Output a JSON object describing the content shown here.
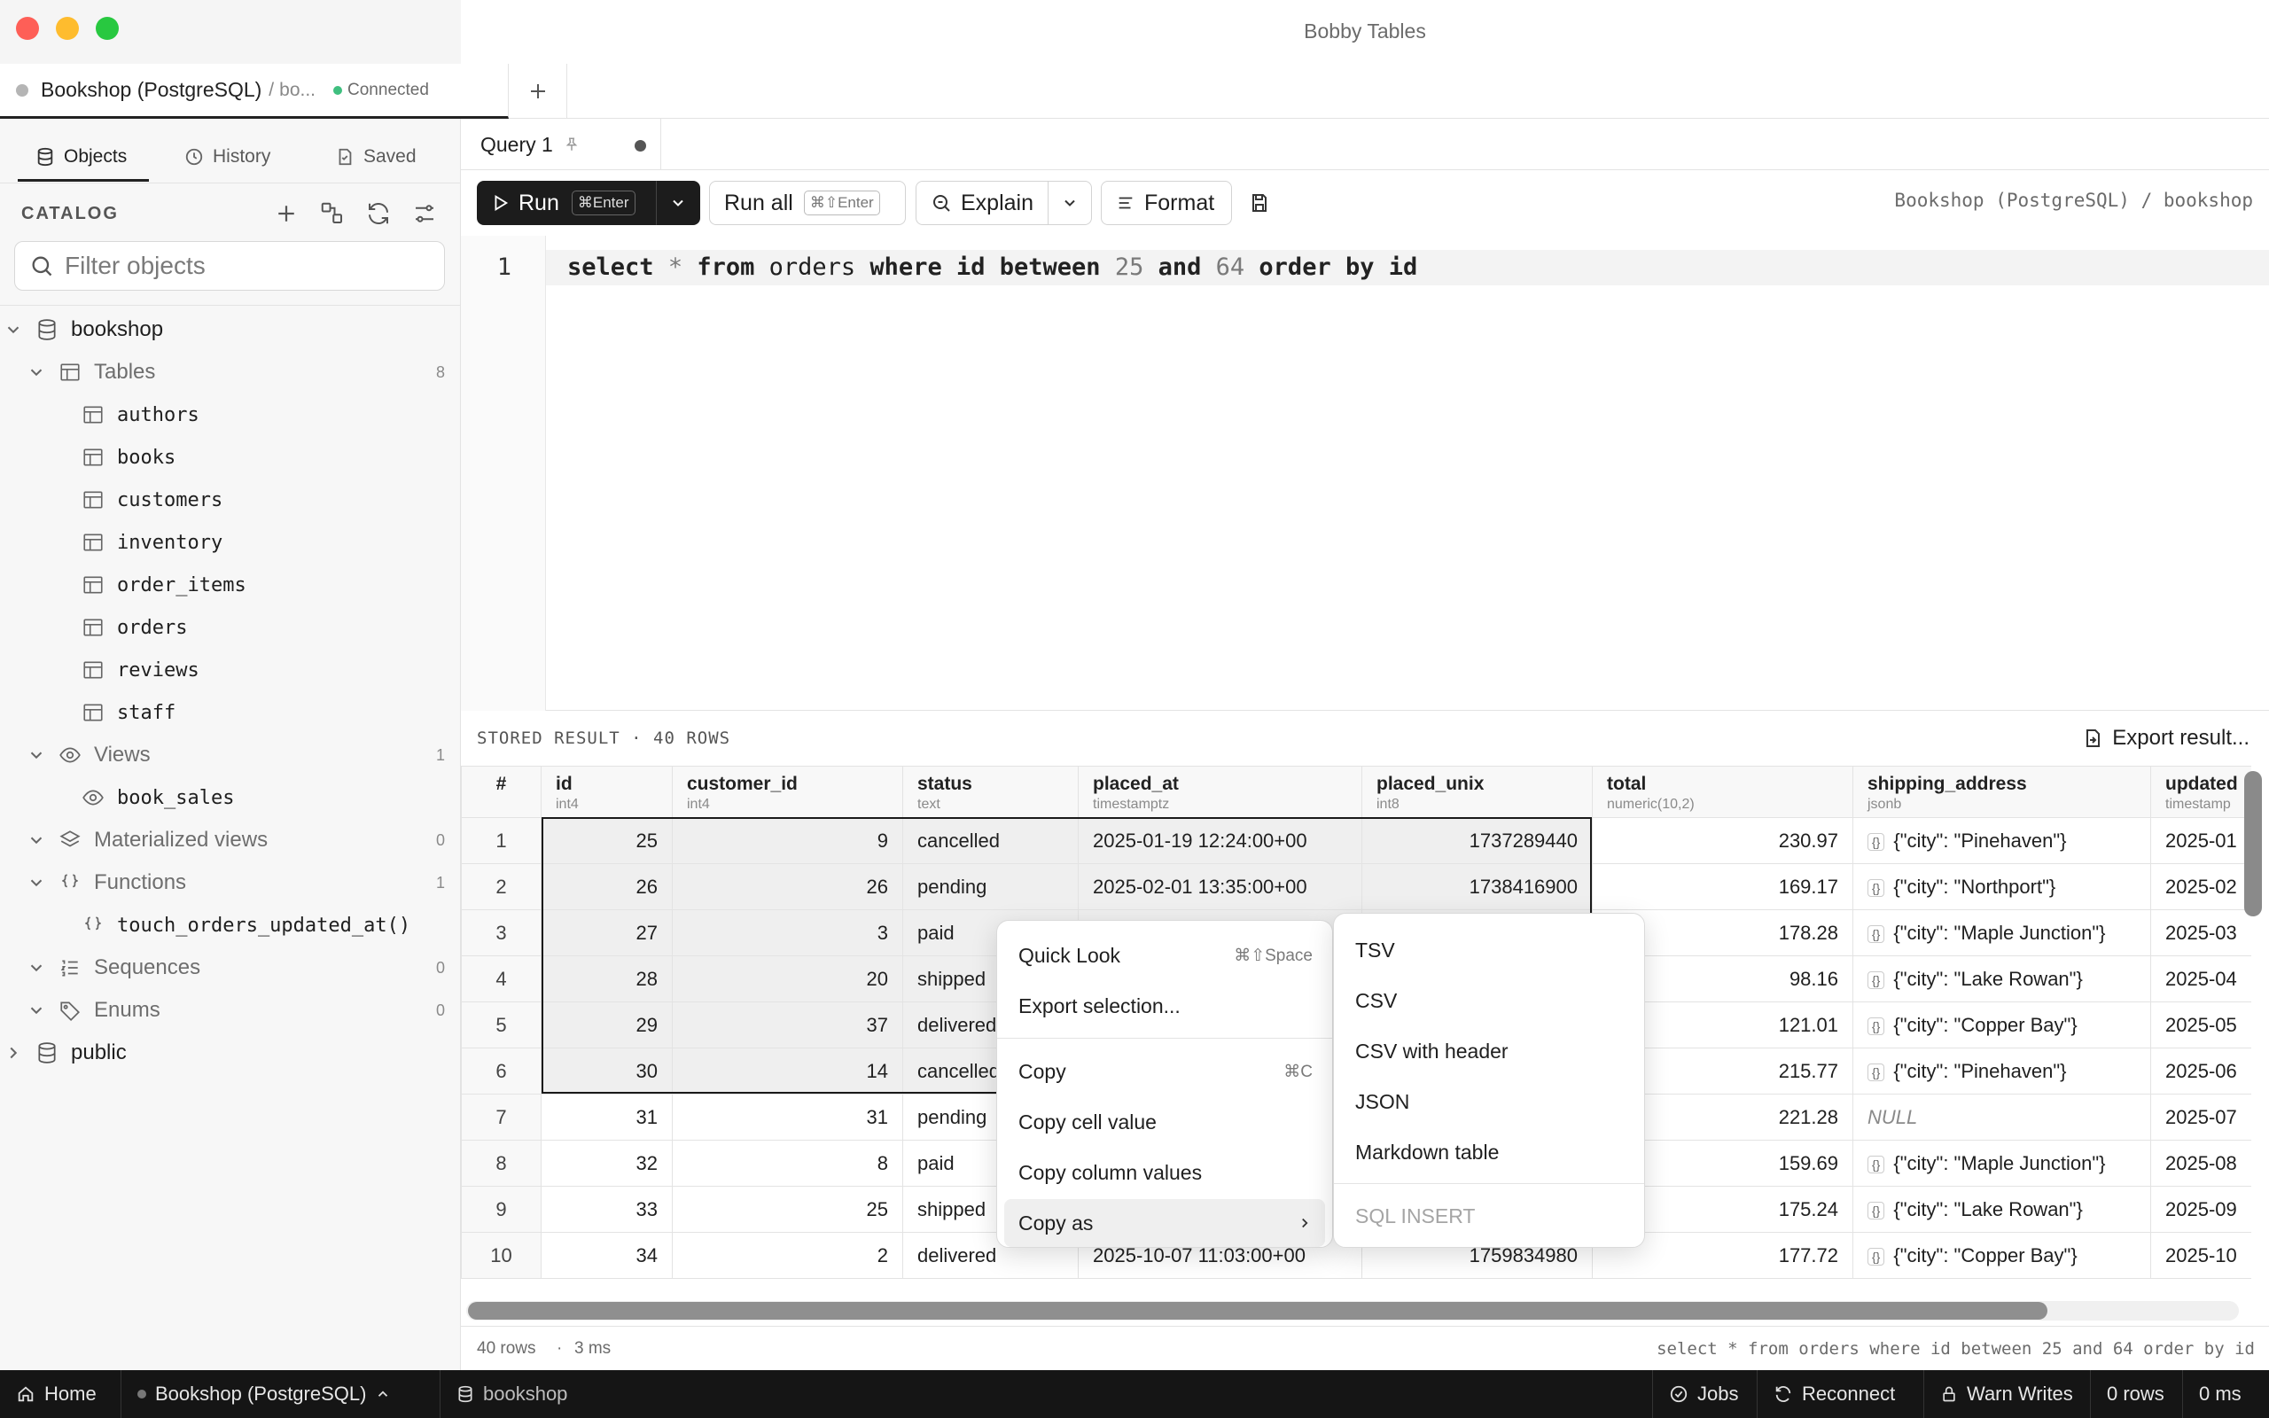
{
  "window": {
    "title": "Bobby Tables"
  },
  "connection_tab": {
    "name": "Bookshop (PostgreSQL)",
    "sep": "/",
    "db_short": "bo...",
    "status": "Connected"
  },
  "sidebar": {
    "tabs": [
      {
        "label": "Objects"
      },
      {
        "label": "History"
      },
      {
        "label": "Saved"
      }
    ],
    "catalog_label": "CATALOG",
    "filter_placeholder": "Filter objects",
    "tree": {
      "db": "bookshop",
      "tables_label": "Tables",
      "tables_count": "8",
      "tables": [
        "authors",
        "books",
        "customers",
        "inventory",
        "order_items",
        "orders",
        "reviews",
        "staff"
      ],
      "views_label": "Views",
      "views_count": "1",
      "views": [
        "book_sales"
      ],
      "mat_views_label": "Materialized views",
      "mat_views_count": "0",
      "functions_label": "Functions",
      "functions_count": "1",
      "functions": [
        "touch_orders_updated_at()"
      ],
      "sequences_label": "Sequences",
      "sequences_count": "0",
      "enums_label": "Enums",
      "enums_count": "0",
      "schema2": "public"
    }
  },
  "query_tab": {
    "label": "Query 1"
  },
  "toolbar": {
    "run": "Run",
    "run_kbd": "⌘Enter",
    "run_all": "Run all",
    "run_all_kbd": "⌘⇧Enter",
    "explain": "Explain",
    "format": "Format",
    "context": "Bookshop (PostgreSQL) / bookshop"
  },
  "editor": {
    "line_no": "1",
    "tokens": [
      {
        "t": "select",
        "c": "kw"
      },
      {
        "t": " ",
        "c": ""
      },
      {
        "t": "*",
        "c": "num"
      },
      {
        "t": " ",
        "c": ""
      },
      {
        "t": "from",
        "c": "kw"
      },
      {
        "t": " orders ",
        "c": ""
      },
      {
        "t": "where",
        "c": "kw"
      },
      {
        "t": " ",
        "c": ""
      },
      {
        "t": "id",
        "c": "kw"
      },
      {
        "t": " ",
        "c": ""
      },
      {
        "t": "between",
        "c": "kw"
      },
      {
        "t": " ",
        "c": ""
      },
      {
        "t": "25",
        "c": "num"
      },
      {
        "t": " ",
        "c": ""
      },
      {
        "t": "and",
        "c": "kw"
      },
      {
        "t": " ",
        "c": ""
      },
      {
        "t": "64",
        "c": "num"
      },
      {
        "t": " ",
        "c": ""
      },
      {
        "t": "order by",
        "c": "kw"
      },
      {
        "t": " ",
        "c": ""
      },
      {
        "t": "id",
        "c": "kw"
      }
    ]
  },
  "results": {
    "header_label": "STORED RESULT · 40 ROWS",
    "export_label": "Export result...",
    "rownum_header": "#",
    "columns": [
      {
        "name": "id",
        "type": "int4"
      },
      {
        "name": "customer_id",
        "type": "int4"
      },
      {
        "name": "status",
        "type": "text"
      },
      {
        "name": "placed_at",
        "type": "timestamptz"
      },
      {
        "name": "placed_unix",
        "type": "int8"
      },
      {
        "name": "total",
        "type": "numeric(10,2)"
      },
      {
        "name": "shipping_address",
        "type": "jsonb"
      },
      {
        "name": "updated",
        "type": "timestamp"
      }
    ],
    "json_badge": "{}",
    "rows": [
      {
        "n": "1",
        "id": "25",
        "cid": "9",
        "status": "cancelled",
        "placed_at": "2025-01-19 12:24:00+00",
        "unix": "1737289440",
        "total": "230.97",
        "addr": "{\"city\": \"Pinehaven\"}",
        "updated": "2025-01"
      },
      {
        "n": "2",
        "id": "26",
        "cid": "26",
        "status": "pending",
        "placed_at": "2025-02-01 13:35:00+00",
        "unix": "1738416900",
        "total": "169.17",
        "addr": "{\"city\": \"Northport\"}",
        "updated": "2025-02"
      },
      {
        "n": "3",
        "id": "27",
        "cid": "3",
        "status": "paid",
        "placed_at": "",
        "unix": "",
        "total": "178.28",
        "addr": "{\"city\": \"Maple Junction\"}",
        "updated": "2025-03"
      },
      {
        "n": "4",
        "id": "28",
        "cid": "20",
        "status": "shipped",
        "placed_at": "",
        "unix": "",
        "total": "98.16",
        "addr": "{\"city\": \"Lake Rowan\"}",
        "updated": "2025-04"
      },
      {
        "n": "5",
        "id": "29",
        "cid": "37",
        "status": "delivered",
        "placed_at": "",
        "unix": "",
        "total": "121.01",
        "addr": "{\"city\": \"Copper Bay\"}",
        "updated": "2025-05"
      },
      {
        "n": "6",
        "id": "30",
        "cid": "14",
        "status": "cancelled",
        "placed_at": "",
        "unix": "",
        "total": "215.77",
        "addr": "{\"city\": \"Pinehaven\"}",
        "updated": "2025-06"
      },
      {
        "n": "7",
        "id": "31",
        "cid": "31",
        "status": "pending",
        "placed_at": "",
        "unix": "",
        "total": "221.28",
        "addr": "NULL",
        "updated": "2025-07"
      },
      {
        "n": "8",
        "id": "32",
        "cid": "8",
        "status": "paid",
        "placed_at": "",
        "unix": "",
        "total": "159.69",
        "addr": "{\"city\": \"Maple Junction\"}",
        "updated": "2025-08"
      },
      {
        "n": "9",
        "id": "33",
        "cid": "25",
        "status": "shipped",
        "placed_at": "",
        "unix": "",
        "total": "175.24",
        "addr": "{\"city\": \"Lake Rowan\"}",
        "updated": "2025-09"
      },
      {
        "n": "10",
        "id": "34",
        "cid": "2",
        "status": "delivered",
        "placed_at": "2025-10-07 11:03:00+00",
        "unix": "1759834980",
        "total": "177.72",
        "addr": "{\"city\": \"Copper Bay\"}",
        "updated": "2025-10"
      }
    ],
    "footer": {
      "rows": "40 rows",
      "sep": "·",
      "time": "3 ms",
      "query": "select * from orders where id between 25 and 64 order by id"
    }
  },
  "context_menu": {
    "items": [
      {
        "label": "Quick Look",
        "shortcut": "⌘⇧Space"
      },
      {
        "label": "Export selection..."
      },
      {
        "label": "Copy",
        "shortcut": "⌘C"
      },
      {
        "label": "Copy cell value"
      },
      {
        "label": "Copy column values"
      },
      {
        "label": "Copy as"
      }
    ],
    "submenu": {
      "items": [
        "TSV",
        "CSV",
        "CSV with header",
        "JSON",
        "Markdown table"
      ],
      "disabled": "SQL INSERT"
    }
  },
  "statusbar": {
    "home": "Home",
    "connection": "Bookshop (PostgreSQL)",
    "database": "bookshop",
    "jobs": "Jobs",
    "reconnect": "Reconnect",
    "warn_writes": "Warn Writes",
    "rows": "0 rows",
    "ms": "0 ms"
  },
  "colors": {
    "close": "#fe5f57",
    "minimize": "#febc2e",
    "zoom": "#28c840",
    "connected": "#3fbf7f",
    "accent": "#1c1c1c"
  }
}
